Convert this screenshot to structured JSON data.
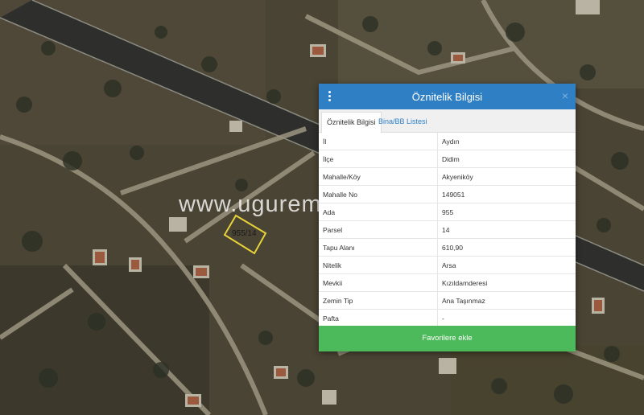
{
  "map": {
    "watermark": "www.ugurem",
    "parcel_label": "955/14"
  },
  "panel": {
    "title": "Öznitelik Bilgisi",
    "close": "×",
    "tabs": [
      "Öznitelik Bilgisi",
      "Bina/BB Listesi"
    ],
    "rows": [
      {
        "key": "İl",
        "value": "Aydın"
      },
      {
        "key": "İlçe",
        "value": "Didim"
      },
      {
        "key": "Mahalle/Köy",
        "value": "Akyeniköy"
      },
      {
        "key": "Mahalle No",
        "value": "149051"
      },
      {
        "key": "Ada",
        "value": "955"
      },
      {
        "key": "Parsel",
        "value": "14"
      },
      {
        "key": "Tapu Alanı",
        "value": "610,90"
      },
      {
        "key": "Nitelik",
        "value": "Arsa"
      },
      {
        "key": "Mevkii",
        "value": "Kızıldamderesi"
      },
      {
        "key": "Zemin Tip",
        "value": "Ana Taşınmaz"
      },
      {
        "key": "Pafta",
        "value": "-"
      }
    ],
    "action_label": "Favorilere ekle"
  },
  "colors": {
    "header": "#2f7fc4",
    "action": "#4cba5a",
    "parcel_outline": "#e8d23a"
  }
}
